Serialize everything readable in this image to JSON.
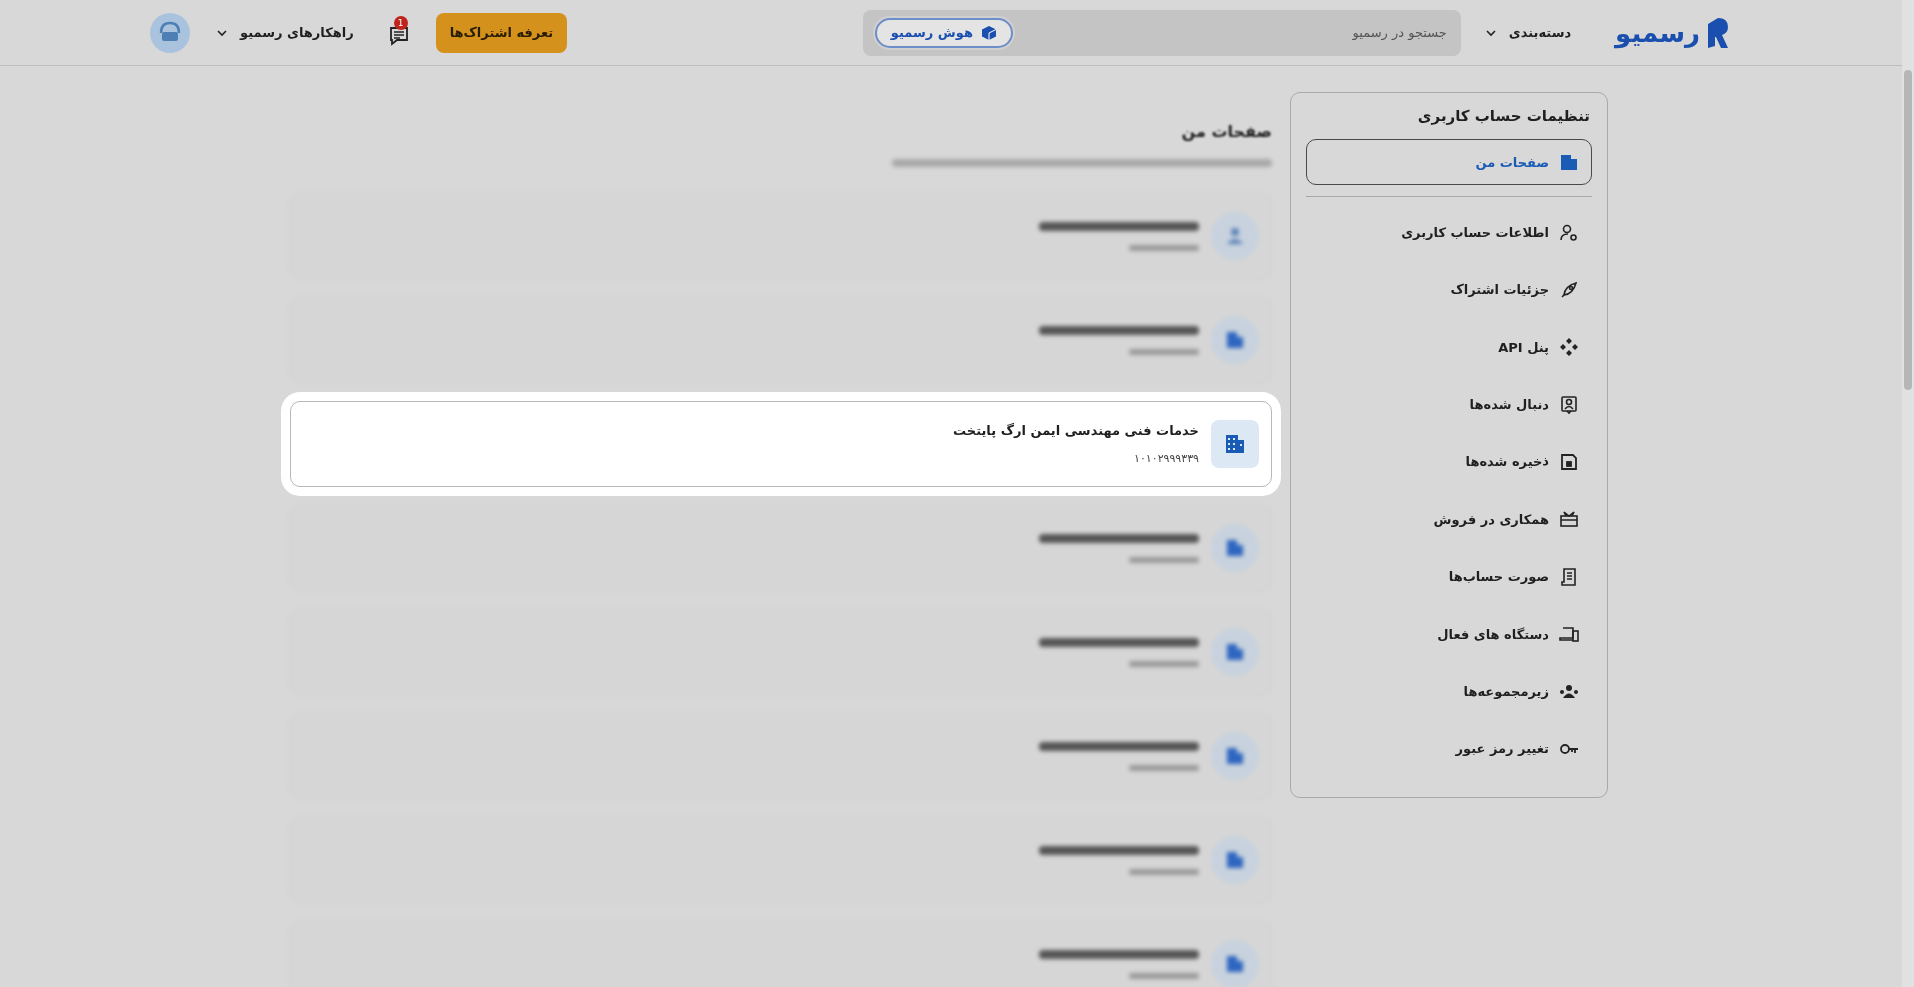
{
  "header": {
    "logo_text": "رسمیو",
    "category_menu": "دسته‌بندی",
    "search": {
      "placeholder": "جستجو در رسمیو",
      "ai_button": "هوش رسمیو"
    },
    "pricing_button": "تعرفه اشتراک‌ها",
    "messages_badge": "1",
    "solutions_menu": "راهکارهای رسمیو"
  },
  "sidebar": {
    "title": "تنظیمات حساب کاربری",
    "items": [
      {
        "label": "صفحات من",
        "selected": true
      },
      {
        "label": "اطلاعات حساب کاربری",
        "selected": false
      },
      {
        "label": "جزئیات اشتراک",
        "selected": false
      },
      {
        "label": "پنل API",
        "selected": false
      },
      {
        "label": "دنبال شده‌ها",
        "selected": false
      },
      {
        "label": "ذخیره شده‌ها",
        "selected": false
      },
      {
        "label": "همکاری در فروش",
        "selected": false
      },
      {
        "label": "صورت حساب‌ها",
        "selected": false
      },
      {
        "label": "دستگاه های فعال",
        "selected": false
      },
      {
        "label": "زیرمجموعه‌ها",
        "selected": false
      },
      {
        "label": "تغییر رمز عبور",
        "selected": false
      }
    ]
  },
  "main": {
    "heading": "صفحات من",
    "cards": [
      {
        "highlighted": false
      },
      {
        "highlighted": false
      },
      {
        "highlighted": true,
        "title": "خدمات فنی مهندسی ایمن ارگ پایتخت",
        "number": "۱۰۱۰۲۹۹۹۳۳۹"
      },
      {
        "highlighted": false
      },
      {
        "highlighted": false
      },
      {
        "highlighted": false
      },
      {
        "highlighted": false
      },
      {
        "highlighted": false
      }
    ]
  }
}
